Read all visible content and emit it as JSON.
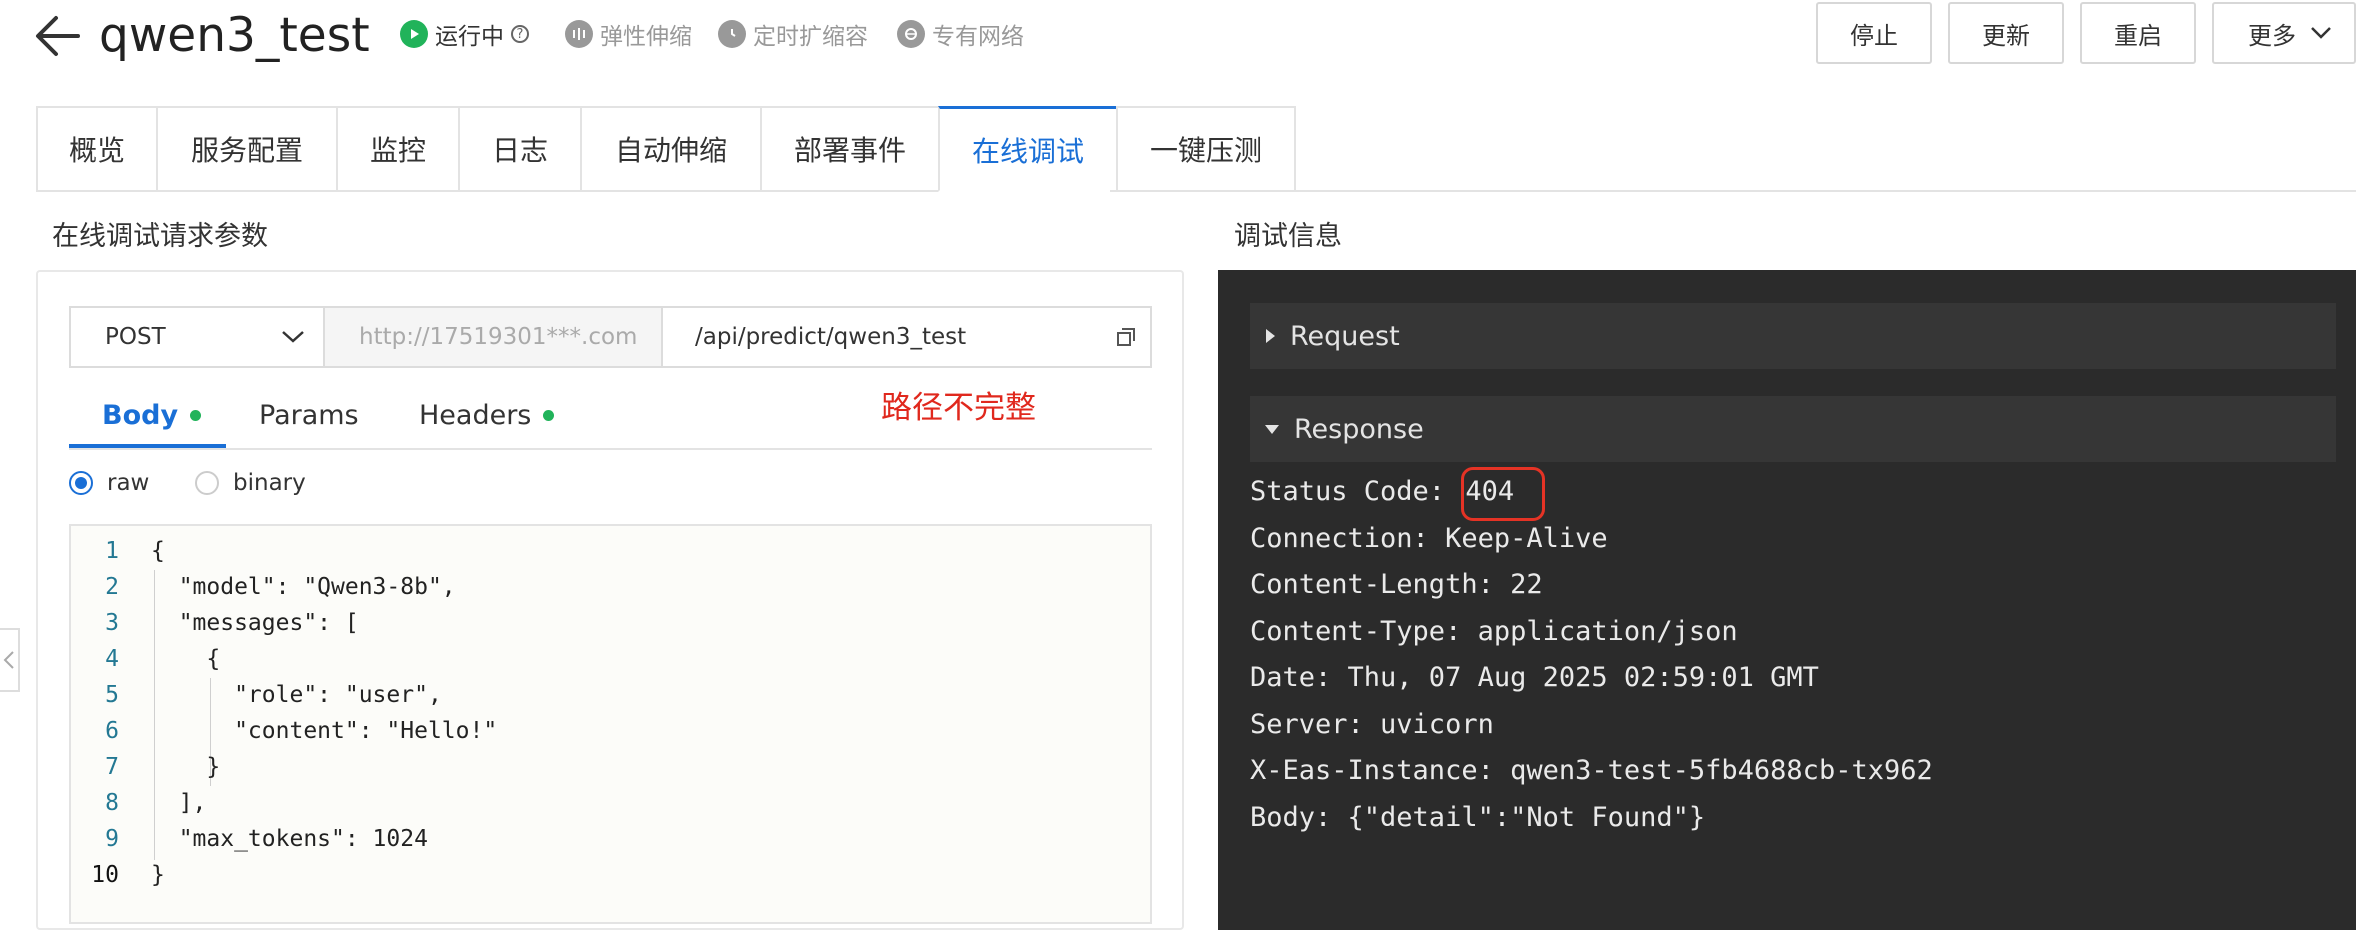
{
  "header": {
    "title": "qwen3_test",
    "status": [
      {
        "label": "运行中",
        "icon": "play-circle-icon",
        "color": "#21b35a"
      },
      {
        "label": "弹性伸缩",
        "icon": "elastic-icon"
      },
      {
        "label": "定时扩缩容",
        "icon": "clock-icon"
      },
      {
        "label": "专有网络",
        "icon": "network-icon"
      }
    ],
    "buttons": {
      "stop": "停止",
      "update": "更新",
      "restart": "重启",
      "more": "更多"
    }
  },
  "tabs": [
    "概览",
    "服务配置",
    "监控",
    "日志",
    "自动伸缩",
    "部署事件",
    "在线调试",
    "一键压测"
  ],
  "active_tab": "在线调试",
  "left": {
    "title": "在线调试请求参数",
    "method": "POST",
    "host": "http://17519301***.com",
    "path": "/api/predict/qwen3_test",
    "subtabs": {
      "body": "Body",
      "params": "Params",
      "headers": "Headers"
    },
    "annotation": "路径不完整",
    "radio": {
      "raw": "raw",
      "binary": "binary"
    },
    "code_lines": [
      "{",
      "  \"model\": \"Qwen3-8b\",",
      "  \"messages\": [",
      "    {",
      "      \"role\": \"user\",",
      "      \"content\": \"Hello!\"",
      "    }",
      "  ],",
      "  \"max_tokens\": 1024",
      "}"
    ],
    "line_numbers": [
      "1",
      "2",
      "3",
      "4",
      "5",
      "6",
      "7",
      "8",
      "9",
      "10"
    ]
  },
  "right": {
    "title": "调试信息",
    "request_label": "Request",
    "response_label": "Response",
    "status_code_label": "Status Code:",
    "status_code": "404",
    "headers": [
      "Connection: Keep-Alive",
      "Content-Length: 22",
      "Content-Type: application/json",
      "Date: Thu, 07 Aug 2025 02:59:01 GMT",
      "Server: uvicorn",
      "X-Eas-Instance: qwen3-test-5fb4688cb-tx962",
      "Body: {\"detail\":\"Not Found\"}"
    ]
  },
  "colors": {
    "accent": "#1a6fd6",
    "ok": "#21b35a",
    "annotation": "#e0281d",
    "dark_panel": "#2b2b2b"
  }
}
